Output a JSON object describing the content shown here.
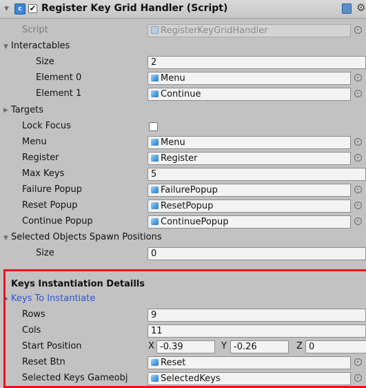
{
  "header": {
    "title": "Register Key Grid Handler (Script)",
    "enabled_checkmark": "✔",
    "script_icon_glyph": "c"
  },
  "script": {
    "label": "Script",
    "value": "RegisterKeyGridHandler"
  },
  "interactables": {
    "label": "Interactables",
    "size_label": "Size",
    "size_value": "2",
    "elements": [
      {
        "label": "Element 0",
        "value": "Menu"
      },
      {
        "label": "Element 1",
        "value": "Continue"
      }
    ]
  },
  "targets": {
    "label": "Targets"
  },
  "lock_focus": {
    "label": "Lock Focus",
    "checked": false
  },
  "menu": {
    "label": "Menu",
    "value": "Menu"
  },
  "register": {
    "label": "Register",
    "value": "Register"
  },
  "max_keys": {
    "label": "Max Keys",
    "value": "5"
  },
  "failure_popup": {
    "label": "Failure Popup",
    "value": "FailurePopup"
  },
  "reset_popup": {
    "label": "Reset Popup",
    "value": "ResetPopup"
  },
  "continue_popup": {
    "label": "Continue Popup",
    "value": "ContinuePopup"
  },
  "spawn_positions": {
    "label": "Selected Objects Spawn Positions",
    "size_label": "Size",
    "size_value": "0"
  },
  "keys_section": {
    "header": "Keys Instantiation Detaills",
    "keys_to_instantiate": "Keys To Instantiate",
    "rows_label": "Rows",
    "rows_value": "9",
    "cols_label": "Cols",
    "cols_value": "11",
    "start_position": {
      "label": "Start Position",
      "x_label": "X",
      "x_value": "-0.39",
      "y_label": "Y",
      "y_value": "-0.26",
      "z_label": "Z",
      "z_value": "0"
    },
    "reset_btn": {
      "label": "Reset Btn",
      "value": "Reset"
    },
    "selected_keys": {
      "label": "Selected Keys Gameobj",
      "value": "SelectedKeys"
    }
  },
  "icons": {
    "fold_expanded": "triangle-down-icon",
    "fold_collapsed": "triangle-right-icon",
    "gameobject": "cube-icon",
    "picker": "object-picker-icon",
    "help": "book-icon",
    "settings": "gear-icon"
  },
  "colors": {
    "panel_bg": "#c2c2c2",
    "prefab_blue": "#4fa3e6",
    "highlight_box": "#e8131a",
    "link_label": "#2a55d6"
  }
}
